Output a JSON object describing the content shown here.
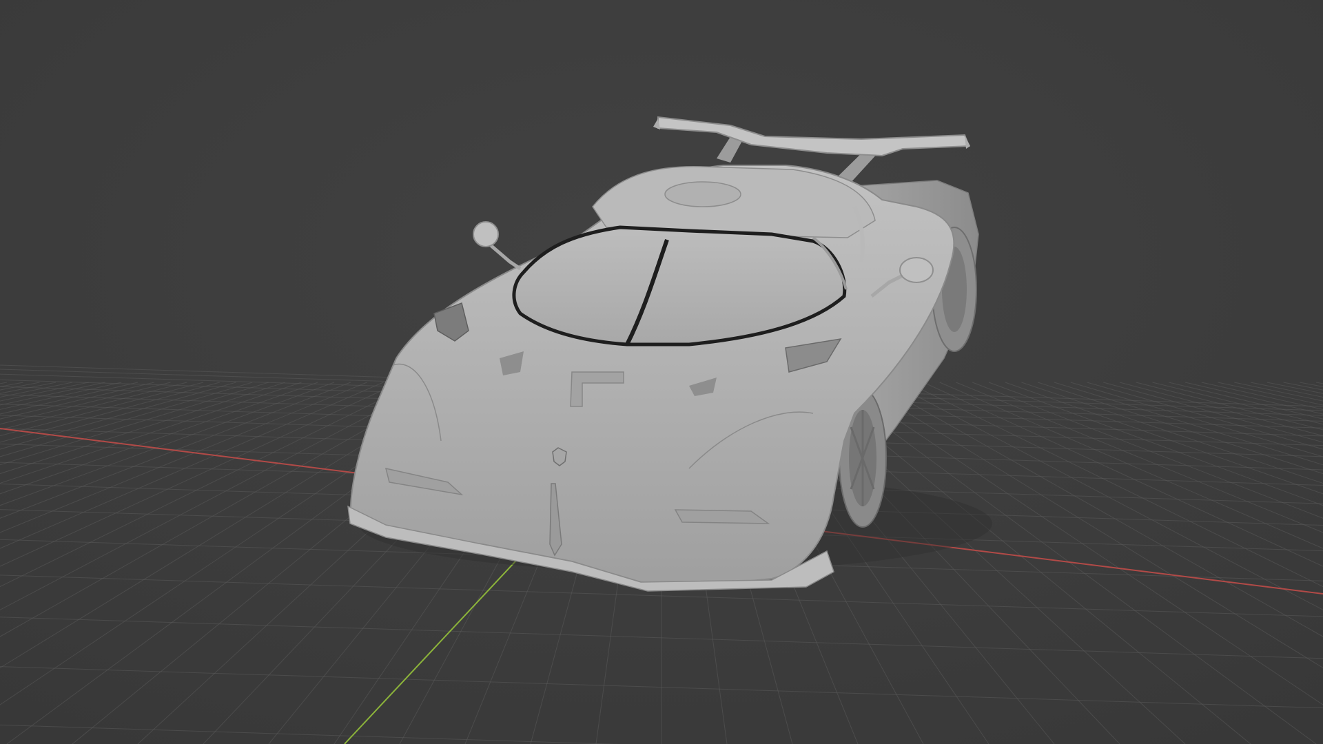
{
  "viewport": {
    "background_color": "#3d3d3d",
    "floor_grid": "on",
    "grid_color": "#5a5a5a",
    "x_axis_color": "#c0504d",
    "y_axis_color": "#8cb43a",
    "model": {
      "kind": "sports-car",
      "shading": "solid",
      "base_color": "#b3b3b3"
    }
  }
}
